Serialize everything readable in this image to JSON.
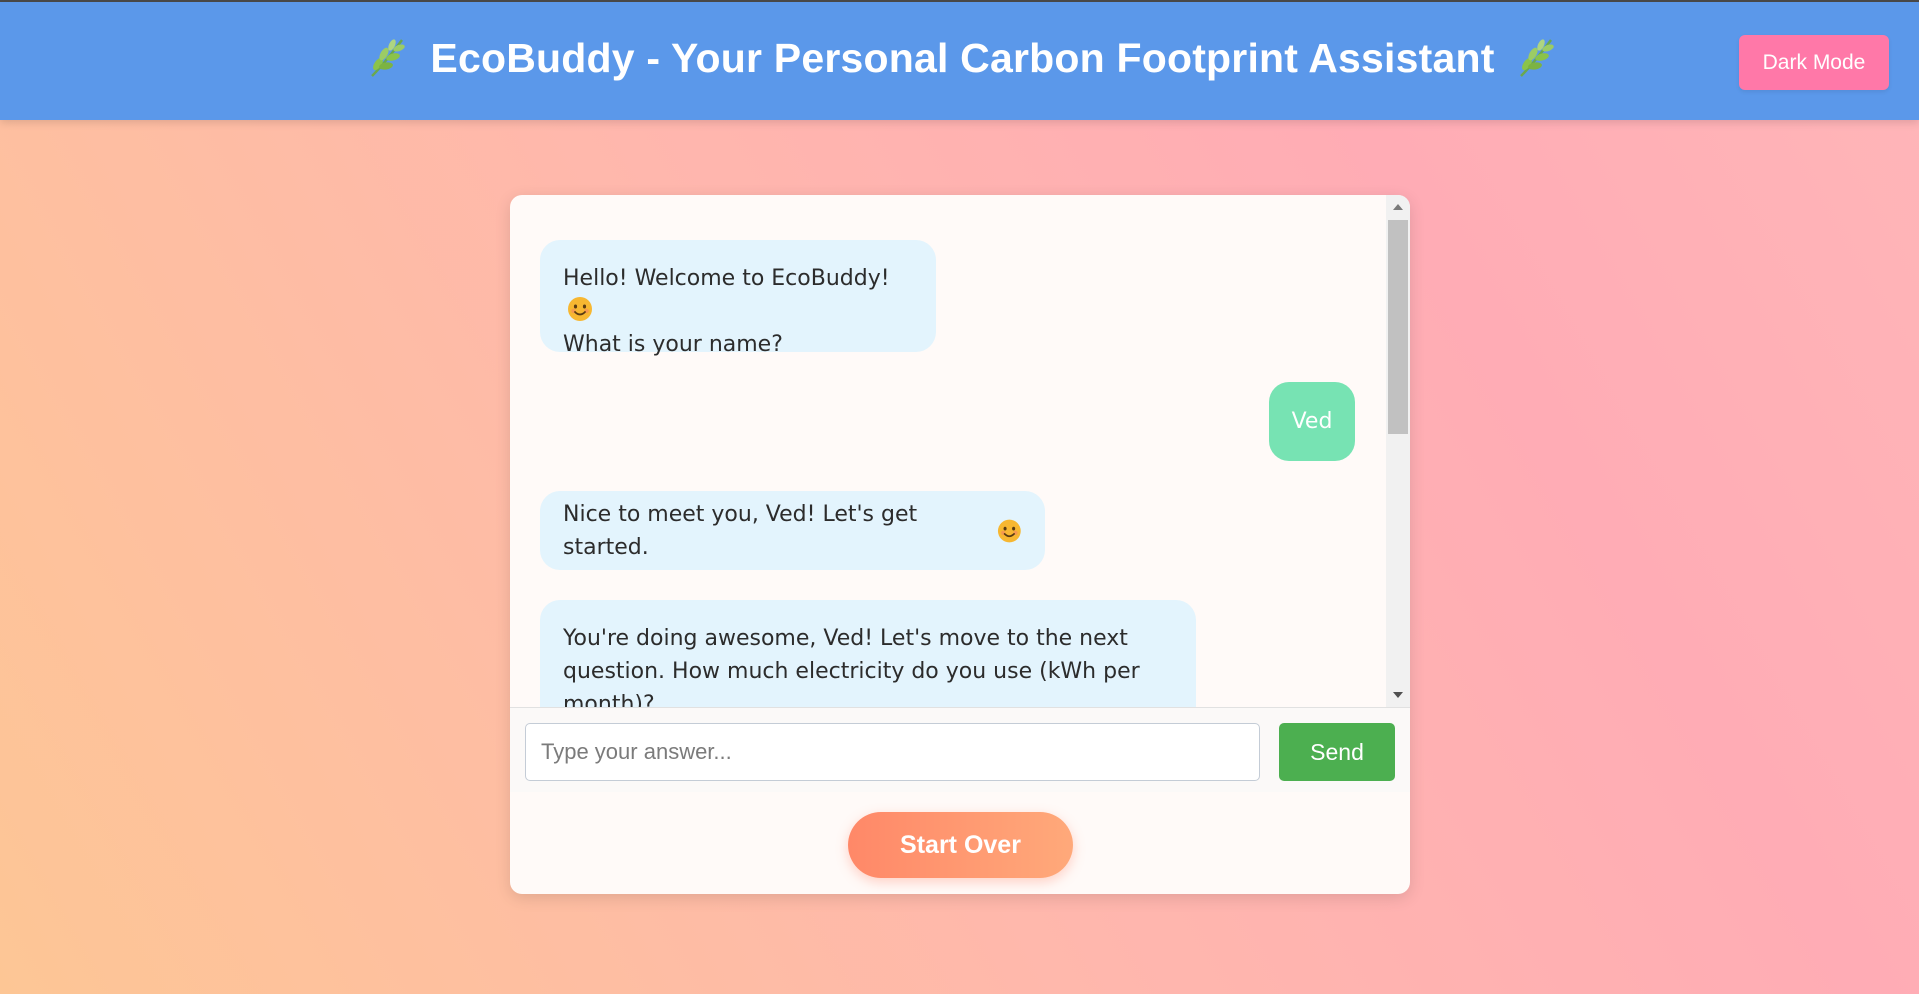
{
  "header": {
    "title": "EcoBuddy - Your Personal Carbon Footprint Assistant",
    "left_icon": "leaf-icon",
    "right_icon": "leaf-icon",
    "background_color": "#5b98ea"
  },
  "toolbar": {
    "dark_mode_label": "Dark Mode",
    "dark_mode_color": "#ff78a8"
  },
  "chat": {
    "messages": [
      {
        "sender": "bot",
        "line1": "Hello! Welcome to EcoBuddy!",
        "line2": "What is your name?",
        "emoji": "smiling-face-icon"
      },
      {
        "sender": "user",
        "text": "Ved"
      },
      {
        "sender": "bot",
        "text": "Nice to meet you, Ved! Let's get started.",
        "emoji": "smiling-face-icon"
      },
      {
        "sender": "bot",
        "line1": "You're doing awesome, Ved! Let's move to the next",
        "line2": "question. How much electricity do you use (kWh per",
        "line3": "month)?"
      }
    ]
  },
  "input": {
    "placeholder": "Type your answer...",
    "value": "",
    "send_label": "Send",
    "send_color": "#4caf50"
  },
  "actions": {
    "start_over_label": "Start Over"
  }
}
